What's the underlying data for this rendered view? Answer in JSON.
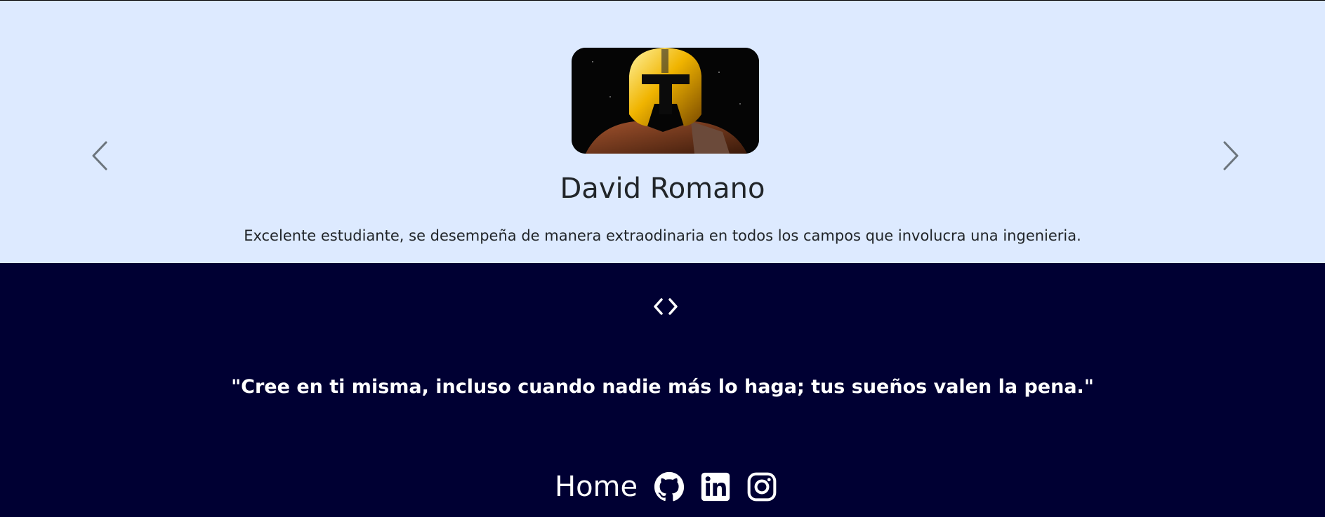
{
  "colors": {
    "carousel_bg": "#ddeaff",
    "footer_bg": "#000033",
    "name_text": "#212529",
    "control": "#6c757d",
    "footer_text": "#ffffff"
  },
  "carousel": {
    "slide": {
      "name": "David Romano",
      "description": "Excelente estudiante, se desempeña de manera extraodinaria en todos los campos que involucra una ingenieria."
    },
    "prev_icon": "chevron-left-icon",
    "next_icon": "chevron-right-icon"
  },
  "footer": {
    "logo_icon": "code-icon",
    "quote": "\"Cree en ti misma, incluso cuando nadie más lo haga; tus sueños valen la pena.\"",
    "nav": {
      "home_label": "Home"
    },
    "social_icons": [
      "github-icon",
      "linkedin-icon",
      "instagram-icon"
    ]
  }
}
